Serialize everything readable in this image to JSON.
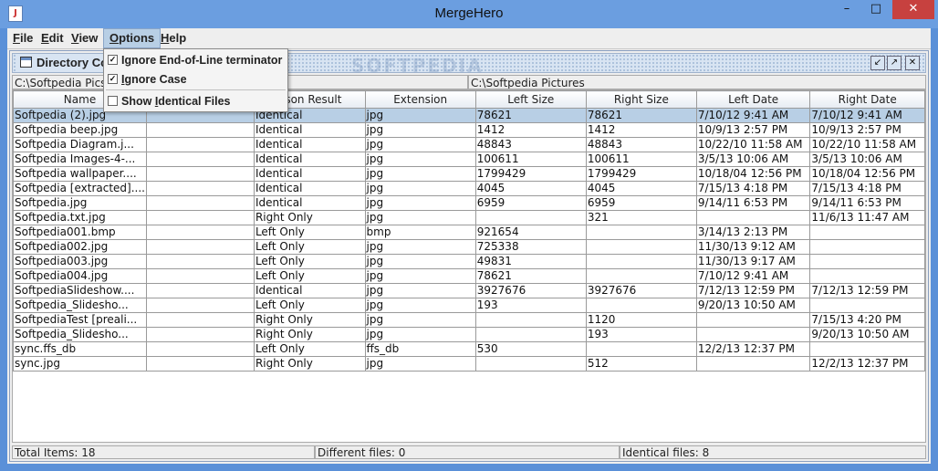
{
  "window": {
    "title": "MergeHero",
    "min": "–",
    "max": "□",
    "close": "✕"
  },
  "menubar": [
    {
      "key": "F",
      "rest": "ile"
    },
    {
      "key": "E",
      "rest": "dit"
    },
    {
      "key": "V",
      "rest": "iew"
    },
    {
      "key": "O",
      "rest": "ptions"
    },
    {
      "key": "H",
      "rest": "elp"
    }
  ],
  "options_menu": {
    "ignore_eol_pre": "I",
    "ignore_eol_u": "g",
    "ignore_eol_rest": "nore End-of-Line terminator",
    "ignore_case_pre": "",
    "ignore_case_u": "I",
    "ignore_case_rest": "gnore Case",
    "show_ident_pre": "Show ",
    "show_ident_u": "I",
    "show_ident_rest": "dentical Files",
    "ignore_eol_checked": true,
    "ignore_case_checked": true,
    "show_ident_checked": false
  },
  "frame": {
    "title": "Directory Co"
  },
  "paths": {
    "left": "C:\\Softpedia Pics",
    "right": "C:\\Softpedia Pictures"
  },
  "columns": [
    "Name",
    "",
    "rison Result",
    "Extension",
    "Left Size",
    "Right Size",
    "Left Date",
    "Right Date"
  ],
  "rows": [
    [
      "Softpedia (2).jpg",
      "",
      "Identical",
      "jpg",
      "78621",
      "78621",
      "7/10/12 9:41 AM",
      "7/10/12 9:41 AM"
    ],
    [
      "Softpedia beep.jpg",
      "",
      "Identical",
      "jpg",
      "1412",
      "1412",
      "10/9/13 2:57 PM",
      "10/9/13 2:57 PM"
    ],
    [
      "Softpedia Diagram.j...",
      "",
      "Identical",
      "jpg",
      "48843",
      "48843",
      "10/22/10 11:58 AM",
      "10/22/10 11:58 AM"
    ],
    [
      "Softpedia Images-4-...",
      "",
      "Identical",
      "jpg",
      "100611",
      "100611",
      "3/5/13 10:06 AM",
      "3/5/13 10:06 AM"
    ],
    [
      "Softpedia wallpaper....",
      "",
      "Identical",
      "jpg",
      "1799429",
      "1799429",
      "10/18/04 12:56 PM",
      "10/18/04 12:56 PM"
    ],
    [
      "Softpedia [extracted]....",
      "",
      "Identical",
      "jpg",
      "4045",
      "4045",
      "7/15/13 4:18 PM",
      "7/15/13 4:18 PM"
    ],
    [
      "Softpedia.jpg",
      "",
      "Identical",
      "jpg",
      "6959",
      "6959",
      "9/14/11 6:53 PM",
      "9/14/11 6:53 PM"
    ],
    [
      "Softpedia.txt.jpg",
      "",
      "Right Only",
      "jpg",
      "",
      "321",
      "",
      "11/6/13 11:47 AM"
    ],
    [
      "Softpedia001.bmp",
      "",
      "Left Only",
      "bmp",
      "921654",
      "",
      "3/14/13 2:13 PM",
      ""
    ],
    [
      "Softpedia002.jpg",
      "",
      "Left Only",
      "jpg",
      "725338",
      "",
      "11/30/13 9:12 AM",
      ""
    ],
    [
      "Softpedia003.jpg",
      "",
      "Left Only",
      "jpg",
      "49831",
      "",
      "11/30/13 9:17 AM",
      ""
    ],
    [
      "Softpedia004.jpg",
      "",
      "Left Only",
      "jpg",
      "78621",
      "",
      "7/10/12 9:41 AM",
      ""
    ],
    [
      "SoftpediaSlideshow....",
      "",
      "Identical",
      "jpg",
      "3927676",
      "3927676",
      "7/12/13 12:59 PM",
      "7/12/13 12:59 PM"
    ],
    [
      "Softpedia_Slidesho...",
      "",
      "Left Only",
      "jpg",
      "193",
      "",
      "9/20/13 10:50 AM",
      ""
    ],
    [
      "SoftpediaTest [preali...",
      "",
      "Right Only",
      "jpg",
      "",
      "1120",
      "",
      "7/15/13 4:20 PM"
    ],
    [
      "Softpedia_Slidesho...",
      "",
      "Right Only",
      "jpg",
      "",
      "193",
      "",
      "9/20/13 10:50 AM"
    ],
    [
      "sync.ffs_db",
      "",
      "Left Only",
      "ffs_db",
      "530",
      "",
      "12/2/13 12:37 PM",
      ""
    ],
    [
      "sync.jpg",
      "",
      "Right Only",
      "jpg",
      "",
      "512",
      "",
      "12/2/13 12:37 PM"
    ]
  ],
  "status": {
    "total": "Total Items: 18",
    "different": "Different files: 0",
    "identical": "Identical files: 8"
  },
  "watermark": "SOFTPEDIA",
  "colors": {
    "selection": "#b8cfe5",
    "titlebar": "#6b9ee0",
    "close": "#c7413f"
  }
}
